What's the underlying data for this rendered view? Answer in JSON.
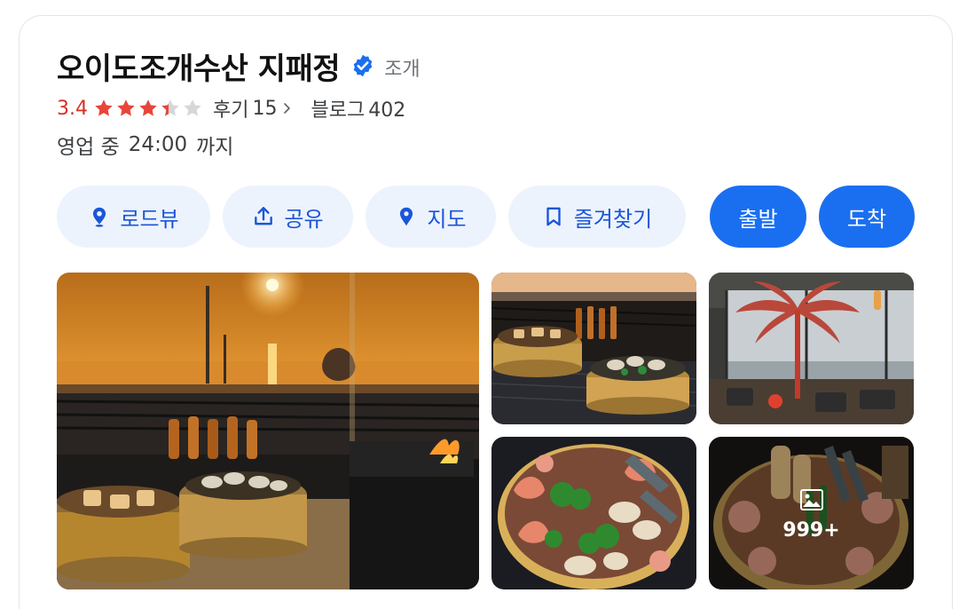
{
  "place": {
    "name": "오이도조개수산 지패정",
    "category": "조개",
    "verified_icon": "verified-badge-icon",
    "rating": "3.4",
    "rating_value": 3.4,
    "rating_max": 5,
    "reviews_label": "후기",
    "reviews_count": "15",
    "blog_label": "블로그",
    "blog_count": "402",
    "status": "영업 중",
    "close_time": "24:00",
    "close_suffix": "까지"
  },
  "actions": {
    "roadview": "로드뷰",
    "share": "공유",
    "map": "지도",
    "favorite": "즐겨찾기",
    "depart": "출발",
    "arrive": "도착"
  },
  "gallery": {
    "more_count": "999+"
  },
  "colors": {
    "accent": "#1a6ff0",
    "accent_light": "#edf3fd",
    "accent_text": "#1a56d8",
    "rating": "#d93025",
    "star": "#e8453c",
    "star_empty": "#d5d7da"
  }
}
